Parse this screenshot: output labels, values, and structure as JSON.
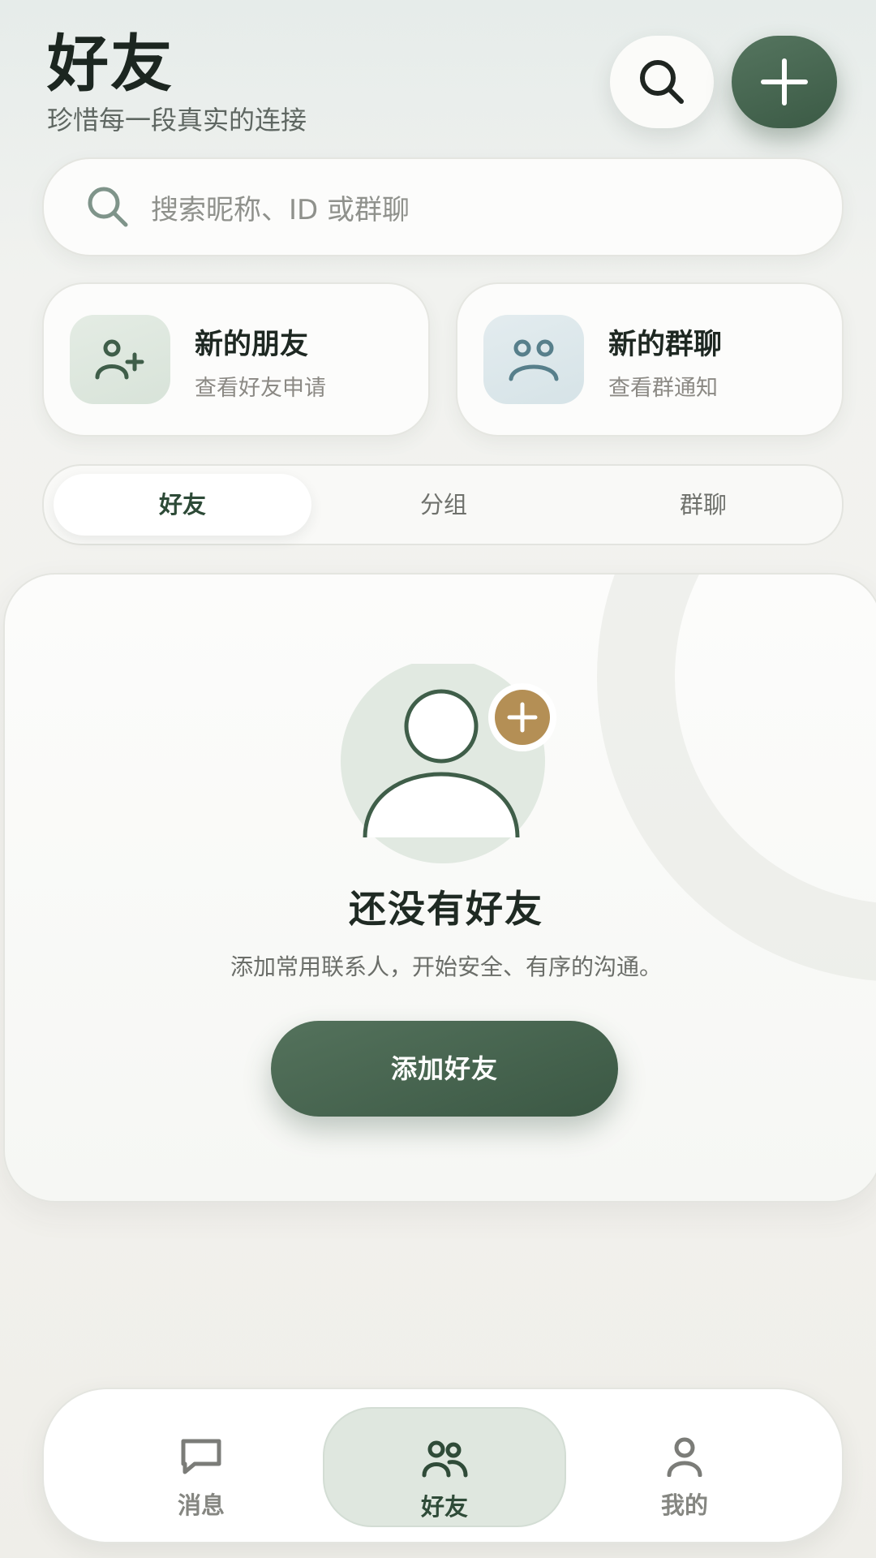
{
  "header": {
    "title": "好友",
    "subtitle": "珍惜每一段真实的连接",
    "search_icon": "search-icon",
    "add_icon": "plus-icon"
  },
  "search": {
    "placeholder": "搜索昵称、ID 或群聊"
  },
  "quick_cards": [
    {
      "icon": "add-person-icon",
      "title": "新的朋友",
      "subtitle": "查看好友申请"
    },
    {
      "icon": "group-icon",
      "title": "新的群聊",
      "subtitle": "查看群通知"
    }
  ],
  "tabs": [
    {
      "label": "好友",
      "active": true
    },
    {
      "label": "分组",
      "active": false
    },
    {
      "label": "群聊",
      "active": false
    }
  ],
  "empty_state": {
    "illustration": "person-add-illustration",
    "title": "还没有好友",
    "description": "添加常用联系人，开始安全、有序的沟通。",
    "button_label": "添加好友"
  },
  "bottom_nav": [
    {
      "icon": "chat-bubble-icon",
      "label": "消息",
      "active": false
    },
    {
      "icon": "friends-icon",
      "label": "好友",
      "active": true
    },
    {
      "icon": "profile-icon",
      "label": "我的",
      "active": false
    }
  ],
  "colors": {
    "accent": "#3f5e49",
    "gold": "#b48f55",
    "background": "#f2f2ee",
    "card": "#fcfcfb"
  }
}
